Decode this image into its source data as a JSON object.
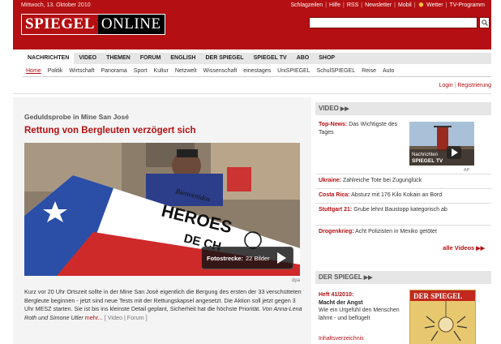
{
  "header": {
    "date": "Mittwoch, 13. Oktober 2010",
    "links": [
      "Schlagzeilen",
      "Hilfe",
      "RSS",
      "Newsletter",
      "Mobil",
      "Wetter",
      "TV-Programm"
    ],
    "logo_left": "SPIEGEL",
    "logo_right": "ONLINE",
    "search_placeholder": "",
    "brand_color": "#b40f12"
  },
  "nav": {
    "items": [
      "NACHRICHTEN",
      "VIDEO",
      "THEMEN",
      "FORUM",
      "ENGLISH",
      "DER SPIEGEL",
      "SPIEGEL TV",
      "ABO",
      "SHOP"
    ],
    "active_index": 0
  },
  "subnav": {
    "items": [
      "Home",
      "Politik",
      "Wirtschaft",
      "Panorama",
      "Sport",
      "Kultur",
      "Netzwelt",
      "Wissenschaft",
      "einestages",
      "UniSPIEGEL",
      "SchulSPIEGEL",
      "Reise",
      "Auto"
    ],
    "active_index": 0
  },
  "account": {
    "login": "Login",
    "register": "Registrierung"
  },
  "article": {
    "kicker": "Geduldsprobe in Mine San José",
    "headline": "Rettung von Bergleuten verzögert sich",
    "photo_credit": "dpa",
    "fotostrecke_label": "Fotostrecke:",
    "fotostrecke_count": "22 Bilder",
    "teaser": "Kurz vor 20 Uhr Ortszeit sollte in der Mine San José eigentlich die Bergung des ersten der 33 verschütteten Bergleute beginnen - jetzt sind neue Tests mit der Rettungskapsel angesetzt. Die Aktion soll jetzt gegen 3 Uhr MESZ starten. Sie ist bis ins kleinste Detail geplant, Sicherheit hat die höchste Priorität.",
    "author": "Von Anna-Lena Roth und Simone Utler",
    "more": "mehr...",
    "meta": "[ Video | Forum ]",
    "flag_text_1": "Bienvenidos",
    "flag_text_2": "HEROES",
    "flag_text_3": "DE CH"
  },
  "video_box": {
    "title": "VIDEO",
    "top_label": "Top-News:",
    "top_text": "Das Wichtigste des Tages",
    "thumb_credit": "AP",
    "thumb_label_1": "Nachrichten",
    "thumb_label_2": "SPIEGEL TV",
    "items": [
      {
        "label": "Ukraine:",
        "text": "Zahlreiche Tote bei Zugunglück"
      },
      {
        "label": "Costa Rica:",
        "text": "Absturz mit 176 Kilo Kokain an Bord"
      },
      {
        "label": "Stuttgart 21:",
        "text": "Grube lehnt Baustopp kategorisch ab"
      },
      {
        "label": "Drogenkrieg:",
        "text": "Acht Polizisten in Mexiko getötet"
      }
    ],
    "all_videos": "alle Videos"
  },
  "spiegel_box": {
    "title": "DER SPIEGEL",
    "issue": "Heft 41/2010:",
    "issue_title": "Macht der Angst",
    "issue_text": "Wie ein Urgefühl den Menschen lähmt - und beflügelt",
    "toc": "Inhaltsverzeichnis",
    "cover_title": "DER SPIEGEL"
  }
}
